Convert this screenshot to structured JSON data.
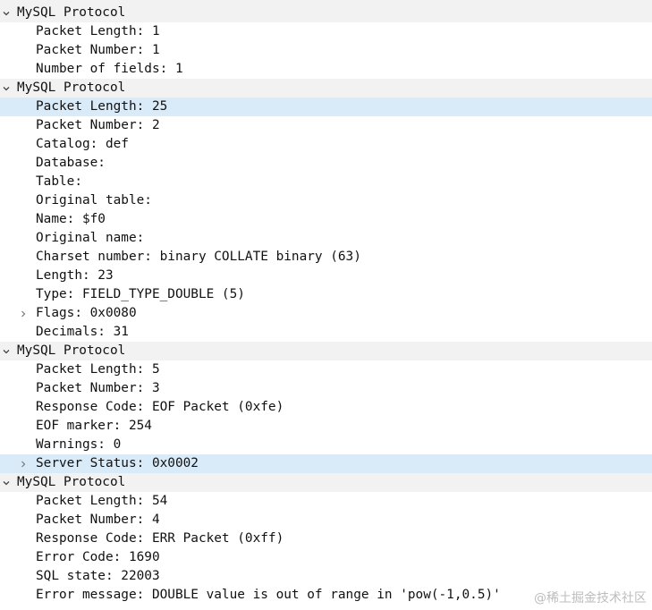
{
  "colors": {
    "header_background": "#f2f2f2",
    "selected_background": "#d9ebf9",
    "text": "#111111"
  },
  "packets": [
    {
      "header": "MySQL Protocol",
      "expanded": true,
      "fields": [
        {
          "label": "Packet Length: 1",
          "expandable": false,
          "selected": false
        },
        {
          "label": "Packet Number: 1",
          "expandable": false,
          "selected": false
        },
        {
          "label": "Number of fields: 1",
          "expandable": false,
          "selected": false
        }
      ]
    },
    {
      "header": "MySQL Protocol",
      "expanded": true,
      "fields": [
        {
          "label": "Packet Length: 25",
          "expandable": false,
          "selected": true
        },
        {
          "label": "Packet Number: 2",
          "expandable": false,
          "selected": false
        },
        {
          "label": "Catalog: def",
          "expandable": false,
          "selected": false
        },
        {
          "label": "Database:",
          "expandable": false,
          "selected": false
        },
        {
          "label": "Table:",
          "expandable": false,
          "selected": false
        },
        {
          "label": "Original table:",
          "expandable": false,
          "selected": false
        },
        {
          "label": "Name: $f0",
          "expandable": false,
          "selected": false
        },
        {
          "label": "Original name:",
          "expandable": false,
          "selected": false
        },
        {
          "label": "Charset number: binary COLLATE binary (63)",
          "expandable": false,
          "selected": false
        },
        {
          "label": "Length: 23",
          "expandable": false,
          "selected": false
        },
        {
          "label": "Type: FIELD_TYPE_DOUBLE (5)",
          "expandable": false,
          "selected": false
        },
        {
          "label": "Flags: 0x0080",
          "expandable": true,
          "selected": false
        },
        {
          "label": "Decimals: 31",
          "expandable": false,
          "selected": false
        }
      ]
    },
    {
      "header": "MySQL Protocol",
      "expanded": true,
      "fields": [
        {
          "label": "Packet Length: 5",
          "expandable": false,
          "selected": false
        },
        {
          "label": "Packet Number: 3",
          "expandable": false,
          "selected": false
        },
        {
          "label": "Response Code: EOF Packet (0xfe)",
          "expandable": false,
          "selected": false
        },
        {
          "label": "EOF marker: 254",
          "expandable": false,
          "selected": false
        },
        {
          "label": "Warnings: 0",
          "expandable": false,
          "selected": false
        },
        {
          "label": "Server Status: 0x0002",
          "expandable": true,
          "selected": true
        }
      ]
    },
    {
      "header": "MySQL Protocol",
      "expanded": true,
      "fields": [
        {
          "label": "Packet Length: 54",
          "expandable": false,
          "selected": false
        },
        {
          "label": "Packet Number: 4",
          "expandable": false,
          "selected": false
        },
        {
          "label": "Response Code: ERR Packet (0xff)",
          "expandable": false,
          "selected": false
        },
        {
          "label": "Error Code: 1690",
          "expandable": false,
          "selected": false
        },
        {
          "label": "SQL state: 22003",
          "expandable": false,
          "selected": false
        },
        {
          "label": "Error message: DOUBLE value is out of range in 'pow(-1,0.5)'",
          "expandable": false,
          "selected": false
        }
      ]
    }
  ],
  "watermark": "@稀土掘金技术社区",
  "icons": {
    "expanded": "chevron-down-icon",
    "collapsed": "chevron-right-icon"
  }
}
